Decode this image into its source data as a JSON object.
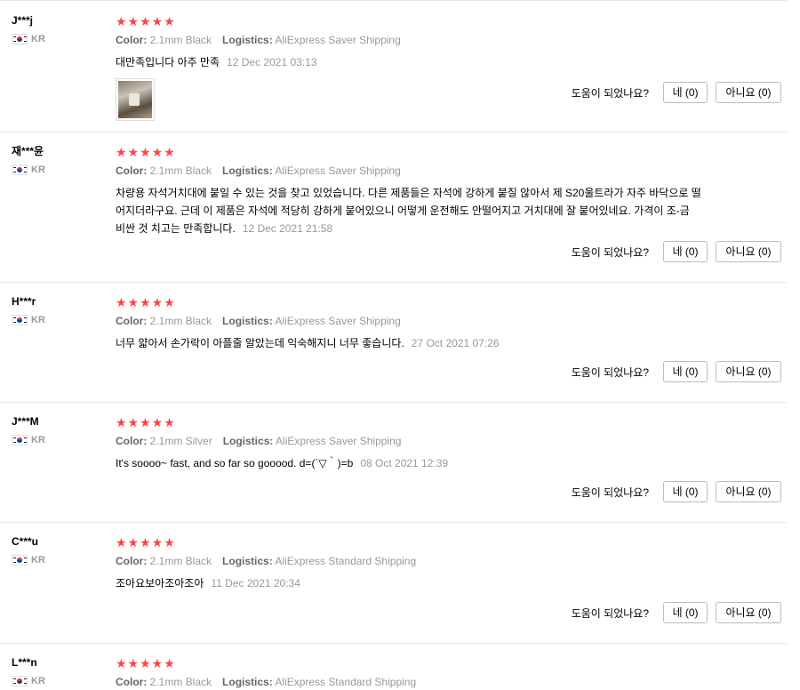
{
  "helpful_question": "도움이 되었나요?",
  "star_count": 5,
  "reviews": [
    {
      "user": "J***j",
      "country": "KR",
      "color_label": "Color:",
      "color_value": "2.1mm Black",
      "logistics_label": "Logistics:",
      "logistics_value": "AliExpress Saver Shipping",
      "text": "대만족입니다 아주 만족",
      "date": "12 Dec 2021 03:13",
      "has_photo": true,
      "yes": "네 (0)",
      "no": "아니요 (0)"
    },
    {
      "user": "재***윤",
      "country": "KR",
      "color_label": "Color:",
      "color_value": "2.1mm Black",
      "logistics_label": "Logistics:",
      "logistics_value": "AliExpress Saver Shipping",
      "text": "차량용 자석거치대에 붙일 수 있는 것을 찾고 있었습니다. 다른 제품들은 자석에 강하게 붙질 않아서 제 S20울트라가 자주 바닥으로 떨어지더라구요. 근데 이 제품은 자석에 적당히 강하게 붙어있으니 어떻게 운전해도 안떨어지고 거치대에 잘 붙어있네요. 가격이 조-금 비싼 것 치고는 만족합니다.",
      "date": "12 Dec 2021 21:58",
      "has_photo": false,
      "yes": "네 (0)",
      "no": "아니요 (0)"
    },
    {
      "user": "H***r",
      "country": "KR",
      "color_label": "Color:",
      "color_value": "2.1mm Black",
      "logistics_label": "Logistics:",
      "logistics_value": "AliExpress Saver Shipping",
      "text": "너무 얇아서 손가락이 아플줄 알았는데 익숙해지니 너무 좋습니다.",
      "date": "27 Oct 2021 07:26",
      "has_photo": false,
      "yes": "네 (0)",
      "no": "아니요 (0)"
    },
    {
      "user": "J***M",
      "country": "KR",
      "color_label": "Color:",
      "color_value": "2.1mm Silver",
      "logistics_label": "Logistics:",
      "logistics_value": "AliExpress Saver Shipping",
      "text": "It's soooo~ fast, and so far so gooood. d=(´▽｀)=b",
      "date": "08 Oct 2021 12:39",
      "has_photo": false,
      "yes": "네 (0)",
      "no": "아니요 (0)"
    },
    {
      "user": "C***u",
      "country": "KR",
      "color_label": "Color:",
      "color_value": "2.1mm Black",
      "logistics_label": "Logistics:",
      "logistics_value": "AliExpress Standard Shipping",
      "text": "조아요보아조아조아",
      "date": "11 Dec 2021 20:34",
      "has_photo": false,
      "yes": "네 (0)",
      "no": "아니요 (0)"
    },
    {
      "user": "L***n",
      "country": "KR",
      "color_label": "Color:",
      "color_value": "2.1mm Black",
      "logistics_label": "Logistics:",
      "logistics_value": "AliExpress Standard Shipping",
      "text": "",
      "date": "",
      "has_photo": false,
      "yes": "",
      "no": ""
    }
  ]
}
